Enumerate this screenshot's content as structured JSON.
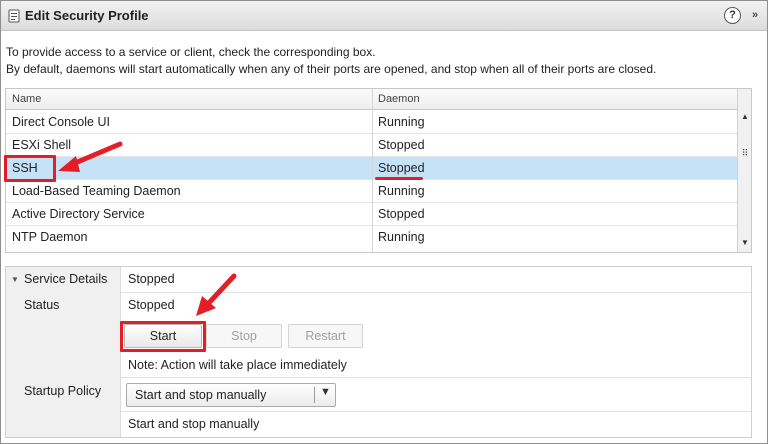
{
  "window": {
    "title": "Edit Security Profile",
    "help_icon": "?",
    "expand_icon": "»"
  },
  "intro": {
    "line1": "To provide access to a service or client, check the corresponding box.",
    "line2": "By default, daemons will start automatically when any of their ports are opened, and stop when all of their ports are closed."
  },
  "grid": {
    "columns": {
      "name": "Name",
      "daemon": "Daemon"
    },
    "rows": [
      {
        "name": "Direct Console UI",
        "daemon": "Running",
        "selected": false
      },
      {
        "name": "ESXi Shell",
        "daemon": "Stopped",
        "selected": false
      },
      {
        "name": "SSH",
        "daemon": "Stopped",
        "selected": true
      },
      {
        "name": "Load-Based Teaming Daemon",
        "daemon": "Running",
        "selected": false
      },
      {
        "name": "Active Directory Service",
        "daemon": "Stopped",
        "selected": false
      },
      {
        "name": "NTP Daemon",
        "daemon": "Running",
        "selected": false
      }
    ]
  },
  "details": {
    "section_label": "Service Details",
    "section_value": "Stopped",
    "status_label": "Status",
    "status_value": "Stopped",
    "buttons": {
      "start": "Start",
      "stop": "Stop",
      "restart": "Restart"
    },
    "note": "Note: Action will take place immediately",
    "startup_policy_label": "Startup Policy",
    "startup_policy_selected": "Start and stop manually",
    "startup_policy_note": "Start and stop manually"
  },
  "colors": {
    "selection": "#c6e2f6",
    "annotation_red": "#e41e26"
  }
}
